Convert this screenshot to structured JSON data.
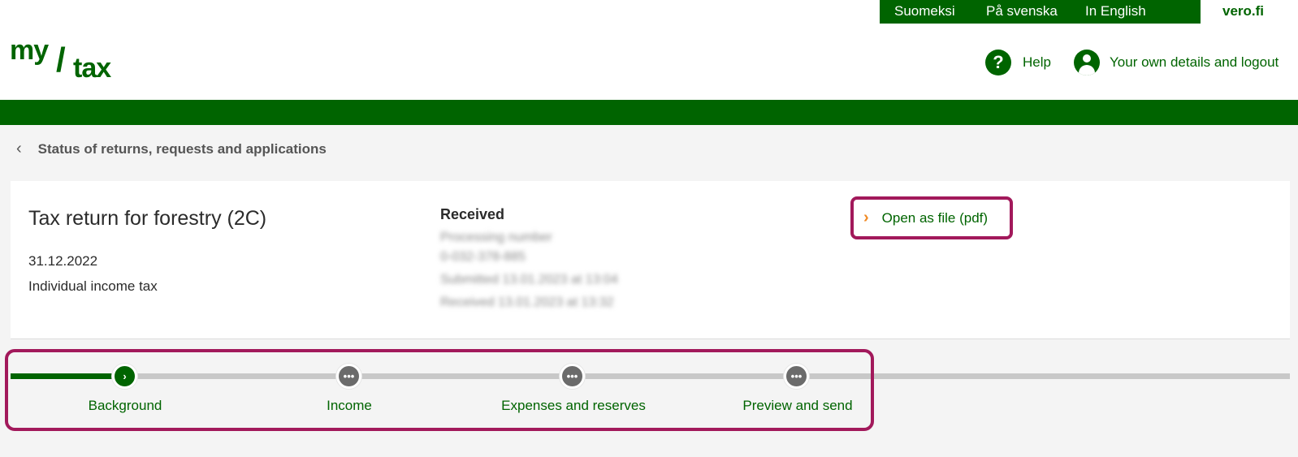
{
  "header": {
    "languages": [
      "Suomeksi",
      "På svenska",
      "In English"
    ],
    "vero_link": "vero.fi",
    "logo": {
      "part1": "my",
      "slash": "/",
      "part2": "tax"
    },
    "help_label": "Help",
    "user_label": "Your own details and logout"
  },
  "breadcrumb": {
    "label": "Status of returns, requests and applications"
  },
  "card": {
    "title": "Tax return for forestry (2C)",
    "date": "31.12.2022",
    "tax_type": "Individual income tax",
    "status": "Received",
    "blurred_lines": [
      "Processing number",
      "0-032-378-885",
      "Submitted 13.01.2023 at 13:04",
      "Received 13.01.2023 at 13:32"
    ],
    "pdf_link": "Open as file (pdf)"
  },
  "stepper": {
    "steps": [
      {
        "label": "Background",
        "state": "active",
        "icon": "›"
      },
      {
        "label": "Income",
        "state": "pending",
        "icon": "•••"
      },
      {
        "label": "Expenses and reserves",
        "state": "pending",
        "icon": "•••"
      },
      {
        "label": "Preview and send",
        "state": "pending",
        "icon": "•••"
      }
    ]
  },
  "colors": {
    "brand_green": "#006400",
    "highlight": "#a2195b",
    "accent_orange": "#f08a24"
  }
}
